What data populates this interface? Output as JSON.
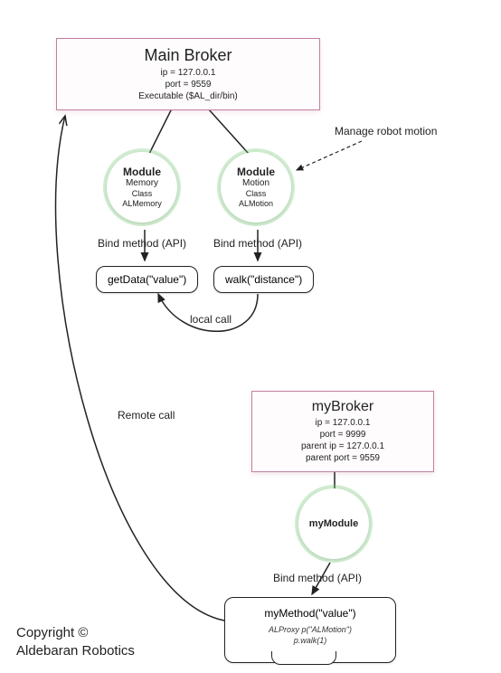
{
  "mainBroker": {
    "title": "Main Broker",
    "ip": "ip = 127.0.0.1",
    "port": "port = 9559",
    "exe": "Executable ($AL_dir/bin)"
  },
  "moduleMemory": {
    "title": "Module",
    "name": "Memory",
    "classLabel": "Class",
    "className": "ALMemory"
  },
  "moduleMotion": {
    "title": "Module",
    "name": "Motion",
    "classLabel": "Class",
    "className": "ALMotion"
  },
  "labels": {
    "bindMethod": "Bind method (API)",
    "manageMotion": "Manage robot motion",
    "localCall": "local call",
    "remoteCall": "Remote call"
  },
  "methods": {
    "getData": "getData(\"value\")",
    "walk": "walk(\"distance\")"
  },
  "myBroker": {
    "title": "myBroker",
    "ip": "ip = 127.0.0.1",
    "port": "port = 9999",
    "parentIp": "parent ip = 127.0.0.1",
    "parentPort": "parent port = 9559"
  },
  "myModule": {
    "title": "myModule"
  },
  "myMethod": {
    "title": "myMethod(\"value\")",
    "code1": "ALProxy p(\"ALMotion\")",
    "code2": "p.walk(1)"
  },
  "copyright": {
    "line1": "Copyright ©",
    "line2": "Aldebaran Robotics"
  }
}
